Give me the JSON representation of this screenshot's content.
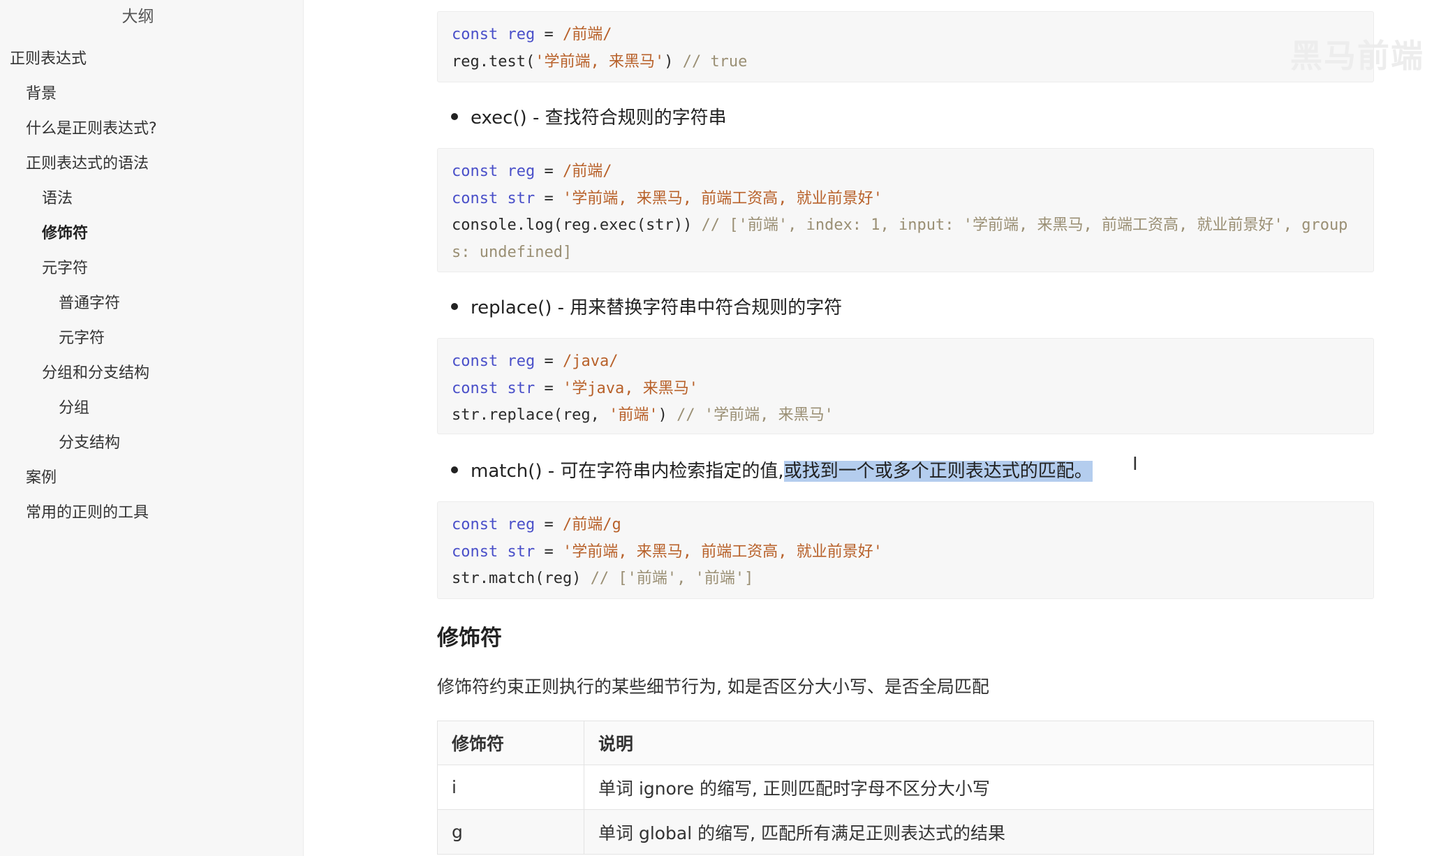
{
  "sidebar": {
    "title": "大纲",
    "items": [
      {
        "label": "正则表达式"
      },
      {
        "label": "背景"
      },
      {
        "label": "什么是正则表达式?"
      },
      {
        "label": "正则表达式的语法"
      },
      {
        "label": "语法"
      },
      {
        "label": "修饰符"
      },
      {
        "label": "元字符"
      },
      {
        "label": "普通字符"
      },
      {
        "label": "元字符"
      },
      {
        "label": "分组和分支结构"
      },
      {
        "label": "分组"
      },
      {
        "label": "分支结构"
      },
      {
        "label": "案例"
      },
      {
        "label": "常用的正则的工具"
      }
    ]
  },
  "content": {
    "code1": {
      "l1_kw1": "const",
      "l1_kw2": "reg",
      "l1_op": " = ",
      "l1_str": "/前端/",
      "l2_code": "reg.test(",
      "l2_str": "'学前端, 来黑马'",
      "l2_code2": ") ",
      "l2_cmt": "// true"
    },
    "bullet_exec": "exec() - 查找符合规则的字符串",
    "code2": {
      "l1_kw1": "const",
      "l1_kw2": "reg",
      "l1_op": " = ",
      "l1_str": "/前端/",
      "l2_kw1": "const",
      "l2_kw2": "str",
      "l2_op": " = ",
      "l2_str": "'学前端, 来黑马, 前端工资高, 就业前景好'",
      "l3_code": "console.log(reg.exec(str)) ",
      "l3_cmt": "// ['前端', index: 1, input: '学前端, 来黑马, 前端工资高, 就业前景好', groups: undefined]"
    },
    "bullet_replace": "replace() - 用来替换字符串中符合规则的字符",
    "code3": {
      "l1_kw1": "const",
      "l1_kw2": "reg",
      "l1_op": " = ",
      "l1_str": "/java/",
      "l2_kw1": "const",
      "l2_kw2": "str",
      "l2_op": " = ",
      "l2_str": "'学java, 来黑马'",
      "l3_code": "str.replace(reg, ",
      "l3_str": "'前端'",
      "l3_code2": ") ",
      "l3_cmt": "// '学前端, 来黑马'"
    },
    "bullet_match_plain": "match() - 可在字符串内检索指定的值,",
    "bullet_match_selected": "或找到一个或多个正则表达式的匹配。",
    "code4": {
      "l1_kw1": "const",
      "l1_kw2": "reg",
      "l1_op": " = ",
      "l1_str": "/前端/g",
      "l2_kw1": "const",
      "l2_kw2": "str",
      "l2_op": " = ",
      "l2_str": "'学前端, 来黑马, 前端工资高, 就业前景好'",
      "l3_code": "str.match(reg) ",
      "l3_cmt": "// ['前端', '前端']"
    },
    "heading": "修饰符",
    "paragraph": "修饰符约束正则执行的某些细节行为, 如是否区分大小写、是否全局匹配",
    "table": {
      "headers": [
        "修饰符",
        "说明"
      ],
      "rows": [
        [
          "i",
          "单词 ignore 的缩写, 正则匹配时字母不区分大小写"
        ],
        [
          "g",
          "单词 global 的缩写, 匹配所有满足正则表达式的结果"
        ]
      ]
    }
  },
  "watermark": "黑马前端",
  "cursor_glyph": "I"
}
